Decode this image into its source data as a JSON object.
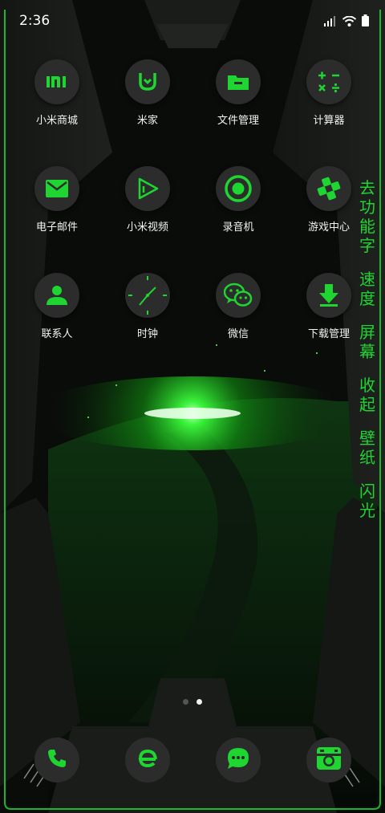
{
  "status": {
    "time": "2:36",
    "icons": [
      "signal-icon",
      "wifi-icon",
      "battery-icon"
    ]
  },
  "colors": {
    "accent": "#1fd531",
    "icon_bg": "#2b2c2b",
    "background": "#0b0d0b"
  },
  "apps": [
    {
      "label": "小米商城",
      "icon": "mi-store-icon"
    },
    {
      "label": "米家",
      "icon": "mijia-icon"
    },
    {
      "label": "文件管理",
      "icon": "folder-icon"
    },
    {
      "label": "计算器",
      "icon": "calculator-icon"
    },
    {
      "label": "电子邮件",
      "icon": "mail-icon"
    },
    {
      "label": "小米视频",
      "icon": "play-icon"
    },
    {
      "label": "录音机",
      "icon": "recorder-icon"
    },
    {
      "label": "游戏中心",
      "icon": "gamepad-icon"
    },
    {
      "label": "联系人",
      "icon": "contact-icon"
    },
    {
      "label": "时钟",
      "icon": "clock-icon"
    },
    {
      "label": "微信",
      "icon": "wechat-icon"
    },
    {
      "label": "下载管理",
      "icon": "download-icon"
    }
  ],
  "side_strip": [
    {
      "line1": "去",
      "line2": "功",
      "line3": "能",
      "line4": "字"
    },
    {
      "line1": "速",
      "line2": "度"
    },
    {
      "line1": "屏",
      "line2": "幕"
    },
    {
      "line1": "收",
      "line2": "起"
    },
    {
      "line1": "壁",
      "line2": "纸"
    },
    {
      "line1": "闪",
      "line2": "光"
    }
  ],
  "pages": {
    "count": 2,
    "active": 2
  },
  "dock": [
    {
      "icon": "phone-icon"
    },
    {
      "icon": "browser-icon"
    },
    {
      "icon": "messages-icon"
    },
    {
      "icon": "camera-icon"
    }
  ]
}
